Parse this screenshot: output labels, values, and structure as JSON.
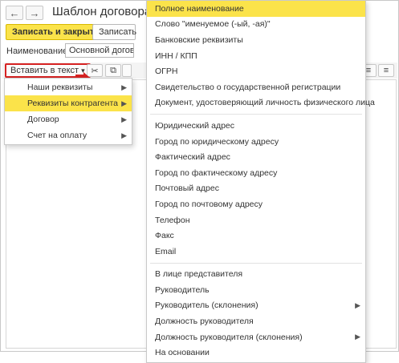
{
  "window": {
    "title": "Шаблон договора"
  },
  "nav": {
    "back_icon": "←",
    "forward_icon": "→"
  },
  "toolbar": {
    "save_close_label": "Записать и закрыть",
    "save_label": "Записать"
  },
  "form": {
    "name_label": "Наименование:",
    "name_value": "Основной договор"
  },
  "editor_toolbar": {
    "insert_label": "Вставить в текст",
    "dropdown_icon": "▾"
  },
  "submenu": {
    "items": [
      {
        "label": "Наши реквизиты",
        "has_submenu": true
      },
      {
        "label": "Реквизиты контрагента",
        "has_submenu": true,
        "active": true
      },
      {
        "label": "Договор",
        "has_submenu": true
      },
      {
        "label": "Счет на оплату",
        "has_submenu": true
      }
    ]
  },
  "main_menu": {
    "groups": [
      [
        {
          "label": "Полное наименование",
          "active": true
        },
        {
          "label": "Слово \"именуемое (-ый, -ая)\""
        },
        {
          "label": "Банковские реквизиты"
        },
        {
          "label": "ИНН / КПП"
        },
        {
          "label": "ОГРН"
        },
        {
          "label": "Свидетельство о государственной регистрации"
        },
        {
          "label": "Документ, удостоверяющий личность физического лица"
        }
      ],
      [
        {
          "label": "Юридический адрес"
        },
        {
          "label": "Город по юридическому адресу"
        },
        {
          "label": "Фактический адрес"
        },
        {
          "label": "Город по фактическому адресу"
        },
        {
          "label": "Почтовый адрес"
        },
        {
          "label": "Город по почтовому адресу"
        },
        {
          "label": "Телефон"
        },
        {
          "label": "Факс"
        },
        {
          "label": "Email"
        }
      ],
      [
        {
          "label": "В лице представителя"
        },
        {
          "label": "Руководитель"
        },
        {
          "label": "Руководитель (склонения)",
          "has_submenu": true
        },
        {
          "label": "Должность руководителя"
        },
        {
          "label": "Должность руководителя (склонения)",
          "has_submenu": true
        },
        {
          "label": "На основании"
        }
      ]
    ]
  },
  "colors": {
    "accent": "#fbe34a",
    "highlight_border": "#d62222"
  }
}
